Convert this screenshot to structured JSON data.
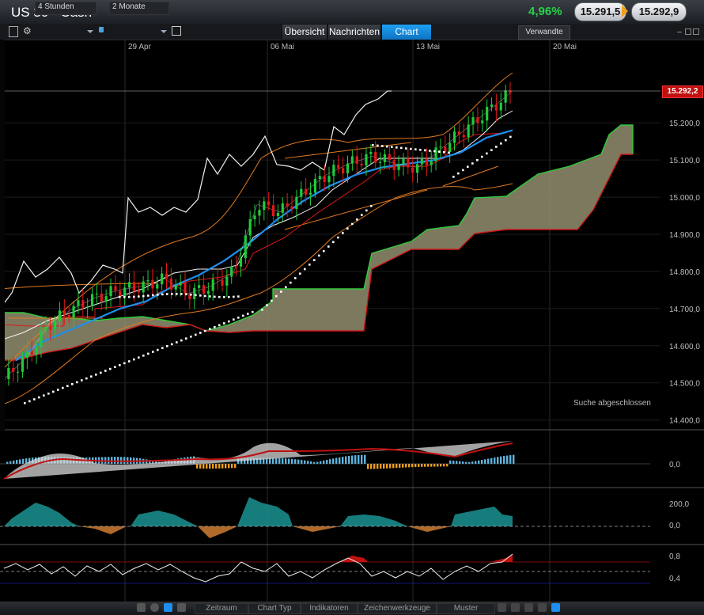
{
  "header": {
    "title": "US 30 - Cash",
    "change_pct": "4,96%",
    "bid": "15.291,5",
    "ask": "15.292,9"
  },
  "toolbar": {
    "interval": "4 Stunden",
    "range": "2 Monate"
  },
  "tabs": [
    {
      "label": "Übersicht"
    },
    {
      "label": "Nachrichten"
    },
    {
      "label": "Chart"
    }
  ],
  "related_button": "Verwandte",
  "status": "Suche abgeschlossen",
  "price_label": "15.292,2",
  "bottom_toolbar": {
    "labels": [
      "Zeitraum",
      "Chart Typ",
      "Indikatoren",
      "Zeichenwerkzeuge",
      "Muster"
    ]
  },
  "colors": {
    "up": "#1ecb3a",
    "down": "#e01818",
    "accent": "#1e8ff0",
    "cloud": "#8e8a6c"
  },
  "chart_data": [
    {
      "type": "line",
      "x_ticks": [
        "29 Apr",
        "06 Mai",
        "13 Mai",
        "20 Mai"
      ],
      "y_ticks": [
        "15.200,0",
        "15.100,0",
        "15.000,0",
        "14.900,0",
        "14.800,0",
        "14.700,0",
        "14.600,0",
        "14.500,0",
        "14.400,0"
      ],
      "ylim": [
        14380,
        15420
      ],
      "last_price": 15292.2,
      "series": [
        {
          "style": "white",
          "values": [
            14700,
            14800,
            14900,
            14780,
            14840,
            14800,
            14780,
            14790,
            15050,
            14990,
            14975,
            15010,
            15000,
            15130,
            15200,
            15240,
            15320,
            15340
          ]
        },
        {
          "style": "close",
          "values": [
            14510,
            14570,
            14660,
            14700,
            14730,
            14750,
            14760,
            14780,
            14740,
            14760,
            14800,
            14980,
            14960,
            15010,
            15060,
            15090,
            15110,
            15090,
            15080,
            15130,
            15180,
            15230,
            15280
          ]
        },
        {
          "style": "blue",
          "values": [
            14560,
            14610,
            14640,
            14670,
            14700,
            14720,
            14760,
            14790,
            14830,
            14880,
            14940,
            14990,
            15030,
            15060,
            15080,
            15090,
            15100,
            15120,
            15160,
            15180
          ]
        }
      ]
    },
    {
      "type": "area",
      "y_ticks": [
        "0,0"
      ]
    },
    {
      "type": "area",
      "y_ticks": [
        "200,0",
        "0,0"
      ]
    },
    {
      "type": "line",
      "y_ticks": [
        "0,8",
        "0,4"
      ]
    }
  ]
}
